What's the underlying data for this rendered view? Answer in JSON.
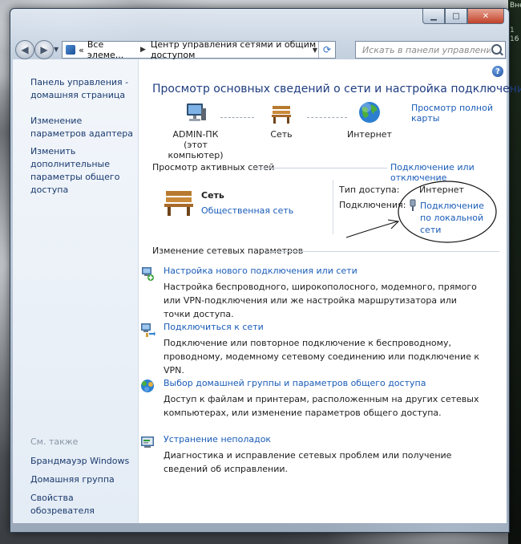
{
  "window": {
    "caption": {
      "minimize": "▁",
      "maximize": "□",
      "close": "✕"
    }
  },
  "navbar": {
    "breadcrumb": [
      {
        "label": "«"
      },
      {
        "label": "Все элеме..."
      },
      {
        "label": "Центр управления сетями и общим доступом"
      }
    ],
    "search_placeholder": "Искать в панели управления"
  },
  "sidebar": {
    "links": [
      "Панель управления - домашняя страница",
      "Изменение параметров адаптера",
      "Изменить дополнительные параметры общего доступа"
    ],
    "see_also_label": "См. также",
    "see_also": [
      "Брандмауэр Windows",
      "Домашняя группа",
      "Свойства обозревателя"
    ]
  },
  "main": {
    "help": "?",
    "title": "Просмотр основных сведений о сети и настройка подключений",
    "full_map_link": "Просмотр полной карты",
    "map": {
      "computer": {
        "line1": "ADMIN-ПК",
        "line2": "(этот компьютер)",
        "icon": "computer-icon"
      },
      "network": {
        "label": "Сеть",
        "icon": "bench-icon"
      },
      "internet": {
        "label": "Интернет",
        "icon": "globe-icon"
      }
    },
    "active": {
      "heading": "Просмотр активных сетей",
      "connect_link": "Подключение или отключение",
      "network_name": "Сеть",
      "network_type": "Общественная сеть",
      "access_label": "Тип доступа:",
      "access_value": "Интернет",
      "connections_label": "Подключения:",
      "connection_value": "Подключение по локальной сети"
    },
    "change": {
      "heading": "Изменение сетевых параметров",
      "tasks": [
        {
          "title": "Настройка нового подключения или сети",
          "desc": "Настройка беспроводного, широкополосного, модемного, прямого или VPN-подключения или же настройка маршрутизатора или точки доступа.",
          "icon": "new-connection-icon"
        },
        {
          "title": "Подключиться к сети",
          "desc": "Подключение или повторное подключение к беспроводному, проводному, модемному сетевому соединению или подключение к VPN.",
          "icon": "connect-network-icon"
        },
        {
          "title": "Выбор домашней группы и параметров общего доступа",
          "desc": "Доступ к файлам и принтерам, расположенным на других сетевых компьютерах, или изменение параметров общего доступа.",
          "icon": "homegroup-icon"
        },
        {
          "title": "Устранение неполадок",
          "desc": "Диагностика и исправление сетевых проблем или получение сведений об исправлении.",
          "icon": "troubleshoot-icon"
        }
      ]
    }
  },
  "desktop_strip": [
    "Вне",
    "1",
    "16"
  ],
  "colors": {
    "link": "#1a5cb8",
    "title": "#1e3c80",
    "sidebar_link": "#1a3a6e"
  }
}
